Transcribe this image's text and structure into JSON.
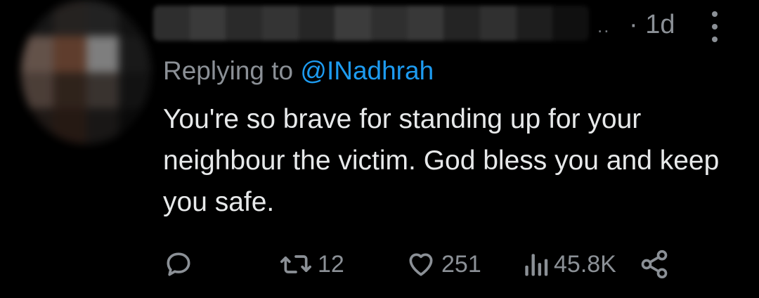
{
  "header": {
    "separator": "..",
    "timestamp": "· 1d"
  },
  "reply_context": {
    "prefix": "Replying to",
    "mention": "@INadhrah"
  },
  "tweet": {
    "text": "You're so brave for standing up for your neighbour the victim. God bless you and keep you safe."
  },
  "actions": {
    "reply_icon": "reply-icon",
    "retweet_icon": "retweet-icon",
    "retweet_count": "12",
    "like_icon": "heart-icon",
    "like_count": "251",
    "views_icon": "views-icon",
    "views_count": "45.8K",
    "share_icon": "share-icon"
  },
  "colors": {
    "background": "#000000",
    "text": "#e7e9ea",
    "muted": "#8b9096",
    "accent": "#1d9bf0"
  }
}
